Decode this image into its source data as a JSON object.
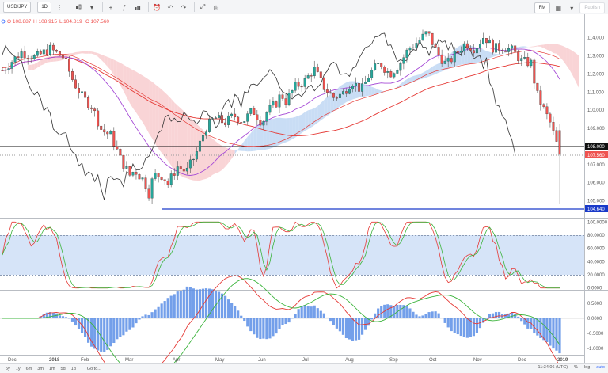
{
  "toolbar": {
    "symbol": "USD/JPY",
    "interval": "1D",
    "right_button": "Publish",
    "template_label": "FM"
  },
  "legend": {
    "open": "O 108.887",
    "high": "H 108.915",
    "low": "L 104.819",
    "close": "C 107.560"
  },
  "price_axis": [
    "114.000",
    "113.000",
    "112.000",
    "111.000",
    "110.000",
    "109.000",
    "108.000",
    "107.000",
    "106.000",
    "105.000"
  ],
  "price_labels": {
    "black_line": "108.000",
    "last": "107.560",
    "blue_line": "104.640"
  },
  "stoch_axis": [
    "100.0000",
    "80.0000",
    "60.0000",
    "40.0000",
    "20.0000",
    "0.0000"
  ],
  "macd_axis": [
    "0.5000",
    "0.0000",
    "-0.5000",
    "-1.0000"
  ],
  "time_axis": [
    "Dec",
    "2018",
    "Feb",
    "Mar",
    "Apr",
    "May",
    "Jun",
    "Jul",
    "Aug",
    "Sep",
    "Oct",
    "Nov",
    "Dec",
    "2019"
  ],
  "bottom_bar": {
    "ranges": [
      "5y",
      "1y",
      "6m",
      "3m",
      "1m",
      "5d",
      "1d"
    ],
    "goto": "Go to...",
    "clock": "11:34:06 (UTC)",
    "percent": "%",
    "log": "log",
    "auto": "auto"
  },
  "colors": {
    "up": "#26a69a",
    "down": "#ef5350",
    "ma_red": "#e53935",
    "ma_purple": "#a64bd6",
    "stoch_band": "#cfe0f7",
    "hline_blue": "#1a3ac9",
    "macd_hist": "#5b8ee6"
  },
  "chart_data": {
    "type": "candlestick",
    "symbol": "USD/JPY",
    "timeframe": "1D",
    "ohlc_last": {
      "open": 108.887,
      "high": 108.915,
      "low": 104.819,
      "close": 107.56
    },
    "price_range": [
      104.5,
      114.6
    ],
    "horizontal_lines": [
      108.0,
      104.64
    ],
    "path_points": [
      [
        0,
        112.2
      ],
      [
        4,
        113.2
      ],
      [
        7,
        112.9
      ],
      [
        10,
        113.4
      ],
      [
        13,
        112.9
      ],
      [
        15,
        111.6
      ],
      [
        17,
        110.7
      ],
      [
        19,
        110.2
      ],
      [
        21,
        108.9
      ],
      [
        23,
        108.6
      ],
      [
        25,
        107.3
      ],
      [
        27,
        106.4
      ],
      [
        28,
        106.7
      ],
      [
        30,
        106.1
      ],
      [
        31,
        105.4
      ],
      [
        32,
        106.4
      ],
      [
        34,
        106.4
      ],
      [
        35,
        105.9
      ],
      [
        37,
        106.9
      ],
      [
        39,
        106.6
      ],
      [
        41,
        107.6
      ],
      [
        43,
        109.0
      ],
      [
        45,
        109.6
      ],
      [
        47,
        109.3
      ],
      [
        49,
        109.7
      ],
      [
        51,
        109.4
      ],
      [
        53,
        110.0
      ],
      [
        55,
        109.3
      ],
      [
        56,
        109.9
      ],
      [
        58,
        110.4
      ],
      [
        59,
        110.9
      ],
      [
        60,
        110.5
      ],
      [
        62,
        111.3
      ],
      [
        64,
        111.6
      ],
      [
        66,
        112.3
      ],
      [
        68,
        111.3
      ],
      [
        70,
        110.7
      ],
      [
        72,
        110.9
      ],
      [
        74,
        111.6
      ],
      [
        76,
        111.1
      ],
      [
        78,
        112.1
      ],
      [
        80,
        112.6
      ],
      [
        82,
        112.0
      ],
      [
        84,
        112.5
      ],
      [
        86,
        113.4
      ],
      [
        88,
        113.8
      ],
      [
        90,
        114.3
      ],
      [
        92,
        113.2
      ],
      [
        94,
        112.5
      ],
      [
        96,
        113.1
      ],
      [
        98,
        113.7
      ],
      [
        100,
        113.4
      ],
      [
        102,
        114.1
      ],
      [
        104,
        113.4
      ],
      [
        106,
        113.5
      ],
      [
        108,
        113.3
      ],
      [
        110,
        112.7
      ],
      [
        112,
        112.6
      ],
      [
        113,
        111.0
      ],
      [
        114,
        110.4
      ],
      [
        116,
        109.3
      ],
      [
        118,
        107.6
      ]
    ]
  }
}
